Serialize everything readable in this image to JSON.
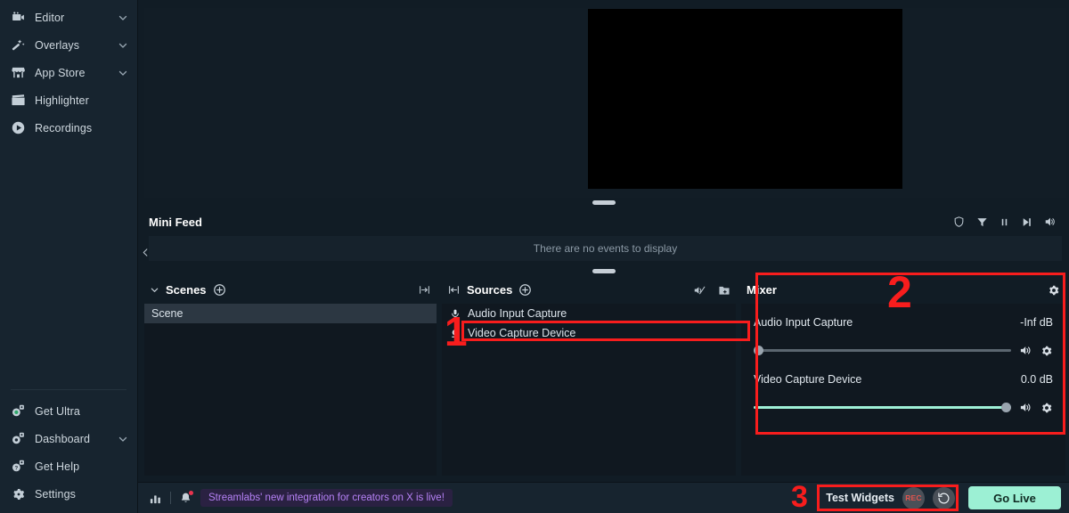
{
  "sidebar": {
    "top_items": [
      {
        "label": "Editor",
        "icon": "video-camera-icon",
        "has_chevron": true
      },
      {
        "label": "Overlays",
        "icon": "magic-wand-icon",
        "has_chevron": true
      },
      {
        "label": "App Store",
        "icon": "store-icon",
        "has_chevron": true
      },
      {
        "label": "Highlighter",
        "icon": "film-clapper-icon",
        "has_chevron": false
      },
      {
        "label": "Recordings",
        "icon": "play-circle-icon",
        "has_chevron": false
      }
    ],
    "bottom_items": [
      {
        "label": "Get Ultra",
        "icon": "ultra-rocket-icon",
        "has_chevron": false
      },
      {
        "label": "Dashboard",
        "icon": "dashboard-icon",
        "has_chevron": true
      },
      {
        "label": "Get Help",
        "icon": "help-icon",
        "has_chevron": false
      },
      {
        "label": "Settings",
        "icon": "gear-icon",
        "has_chevron": false
      }
    ],
    "collapse_icon": "chevron-left-icon"
  },
  "minifeed": {
    "title": "Mini Feed",
    "empty_text": "There are no events to display",
    "icons": [
      "shield-icon",
      "filter-icon",
      "pause-icon",
      "skip-next-icon",
      "volume-icon"
    ]
  },
  "scenes": {
    "title": "Scenes",
    "add_icon": "plus-circle-icon",
    "collapse_icon": "collapse-horizontal-icon",
    "items": [
      {
        "label": "Scene",
        "selected": true
      }
    ]
  },
  "sources": {
    "title": "Sources",
    "add_icon": "plus-circle-icon",
    "expand_icon": "expand-horizontal-icon",
    "header_icons": [
      "audio-muted-icon",
      "add-folder-icon"
    ],
    "items": [
      {
        "label": "Audio Input Capture",
        "icon": "microphone-icon",
        "selected": false
      },
      {
        "label": "Video Capture Device",
        "icon": "webcam-icon",
        "selected": false
      }
    ]
  },
  "mixer": {
    "title": "Mixer",
    "settings_icon": "gear-icon",
    "channels": [
      {
        "name": "Audio Input Capture",
        "db": "-Inf dB",
        "volume_percent": 0,
        "volume_icon": "volume-icon",
        "settings_icon": "gear-icon"
      },
      {
        "name": "Video Capture Device",
        "db": "0.0 dB",
        "volume_percent": 100,
        "volume_icon": "volume-icon",
        "settings_icon": "gear-icon"
      }
    ]
  },
  "bottombar": {
    "stats_icon": "bar-chart-icon",
    "bell_icon": "bell-icon",
    "notification": "Streamlabs' new integration for creators on X is live!",
    "test_widgets_label": "Test Widgets",
    "rec_label": "REC",
    "replay_icon": "replay-icon",
    "go_live_label": "Go Live"
  },
  "annotations": {
    "one": "1",
    "two": "2",
    "three": "3"
  },
  "colors": {
    "accent_mint": "#9cf0d4",
    "annotation_red": "#f81d1d",
    "notification_purple": "#b581f5",
    "sidebar_bg": "#17242f",
    "panel_bg": "#101820"
  }
}
